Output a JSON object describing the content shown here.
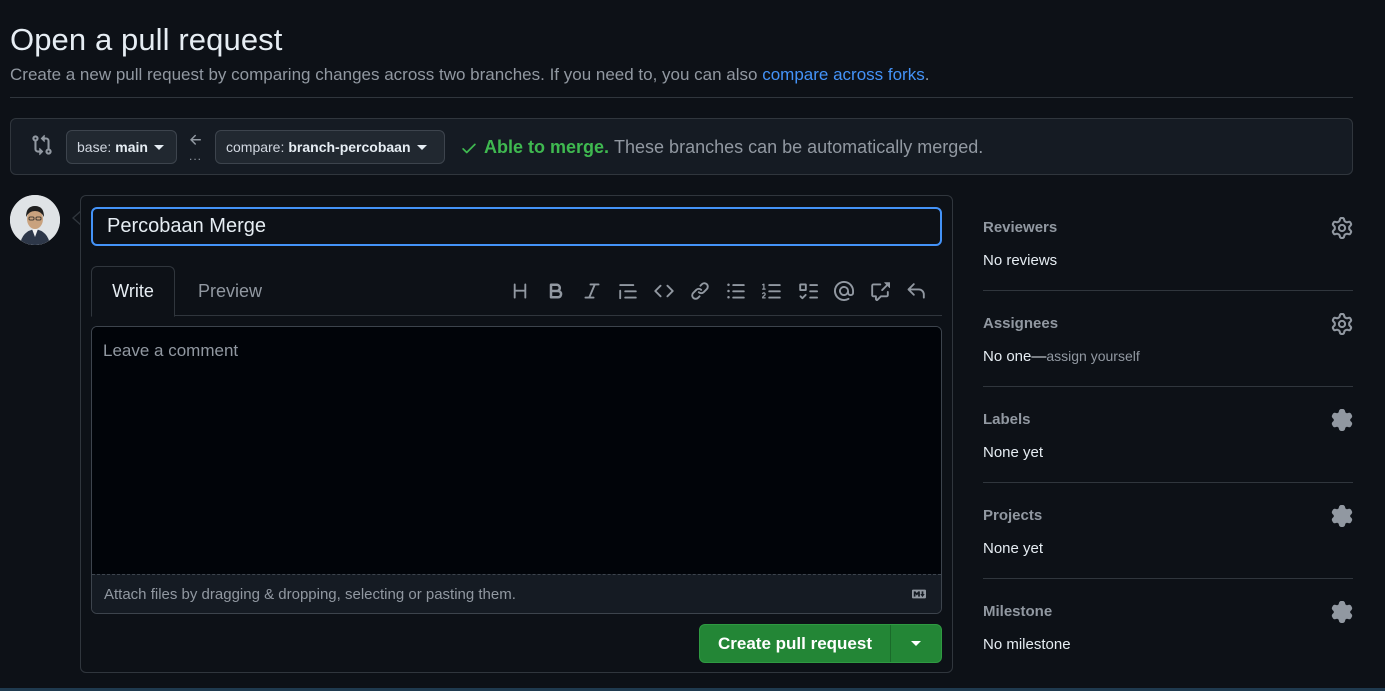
{
  "header": {
    "title": "Open a pull request",
    "subtitle": "Create a new pull request by comparing changes across two branches. If you need to, you can also ",
    "subtitle_link": "compare across forks",
    "subtitle_end": "."
  },
  "range": {
    "base_prefix": "base:",
    "base_branch": "main",
    "compare_prefix": "compare:",
    "compare_branch": "branch-percobaan",
    "dots": "...",
    "merge_ok": "Able to merge.",
    "merge_msg": "These branches can be automatically merged."
  },
  "composer": {
    "title_value": "Percobaan Merge",
    "tab_write": "Write",
    "tab_preview": "Preview",
    "comment_placeholder": "Leave a comment",
    "attach_text": "Attach files by dragging & dropping, selecting or pasting them.",
    "create_label": "Create pull request",
    "toolbar_icons": [
      "heading-icon",
      "bold-icon",
      "italic-icon",
      "quote-icon",
      "code-icon",
      "link-icon",
      "unordered-list-icon",
      "ordered-list-icon",
      "task-list-icon",
      "mention-icon",
      "cross-reference-icon",
      "reply-icon"
    ]
  },
  "sidebar": {
    "reviewers_label": "Reviewers",
    "reviewers_value": "No reviews",
    "assignees_label": "Assignees",
    "assignees_value": "No one—",
    "assignees_link": "assign yourself",
    "labels_label": "Labels",
    "labels_value": "None yet",
    "projects_label": "Projects",
    "projects_value": "None yet",
    "milestone_label": "Milestone",
    "milestone_value": "No milestone"
  },
  "colors": {
    "background": "#0d1117",
    "accent_blue": "#4493f8",
    "success_green": "#3fb950",
    "button_green": "#238636"
  }
}
